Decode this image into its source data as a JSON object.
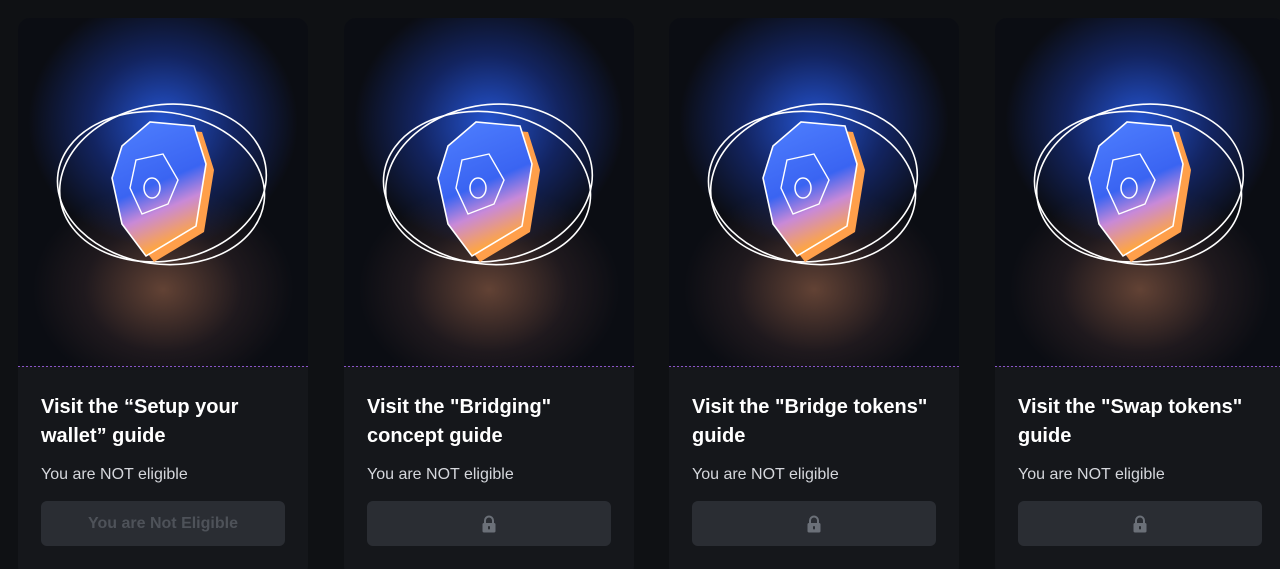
{
  "cards": [
    {
      "title": "Visit the “Setup your wallet” guide",
      "status": "You are NOT eligible",
      "button_label": "You are Not Eligible",
      "button_icon": null
    },
    {
      "title": "Visit the \"Bridging\" concept guide",
      "status": "You are NOT eligible",
      "button_label": "",
      "button_icon": "lock-icon"
    },
    {
      "title": "Visit the \"Bridge tokens\" guide",
      "status": "You are NOT eligible",
      "button_label": "",
      "button_icon": "lock-icon"
    },
    {
      "title": "Visit the \"Swap tokens\" guide",
      "status": "You are NOT eligible",
      "button_label": "",
      "button_icon": "lock-icon"
    }
  ],
  "colors": {
    "page_bg": "#0f1114",
    "card_bg": "#15171b",
    "button_bg": "#2a2d33",
    "button_text": "#4e5259",
    "accent_blue": "#3a6df5",
    "accent_orange": "#ff9a4a"
  }
}
